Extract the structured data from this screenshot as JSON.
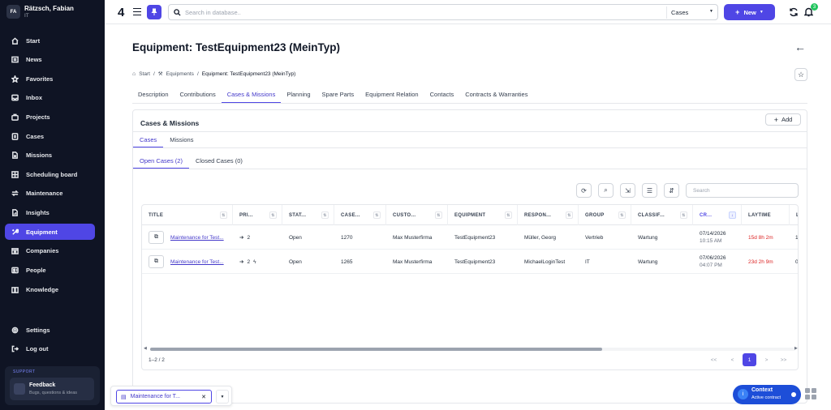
{
  "user": {
    "initials": "FA",
    "name": "Rätzsch, Fabian",
    "department": "IT"
  },
  "sidebar": {
    "items": [
      {
        "label": "Start",
        "icon": "home-icon"
      },
      {
        "label": "News",
        "icon": "newspaper-icon"
      },
      {
        "label": "Favorites",
        "icon": "star-icon"
      },
      {
        "label": "Inbox",
        "icon": "inbox-icon"
      },
      {
        "label": "Projects",
        "icon": "briefcase-icon"
      },
      {
        "label": "Cases",
        "icon": "cases-icon"
      },
      {
        "label": "Missions",
        "icon": "document-icon"
      },
      {
        "label": "Scheduling board",
        "icon": "grid-icon"
      },
      {
        "label": "Maintenance",
        "icon": "arrows-icon"
      },
      {
        "label": "Insights",
        "icon": "chart-icon"
      },
      {
        "label": "Equipment",
        "icon": "wrench-icon",
        "active": true
      },
      {
        "label": "Companies",
        "icon": "building-icon"
      },
      {
        "label": "People",
        "icon": "people-icon"
      },
      {
        "label": "Knowledge",
        "icon": "book-icon"
      }
    ],
    "settings_label": "Settings",
    "logout_label": "Log out",
    "support_label": "SUPPORT",
    "feedback_title": "Feedback",
    "feedback_sub": "Bugs, questions & ideas"
  },
  "topbar": {
    "logo": "4",
    "search_placeholder": "Search in database..",
    "scope": "Cases",
    "new_label": "New",
    "notification_count": "3"
  },
  "page": {
    "title": "Equipment: TestEquipment23 (MeinTyp)",
    "breadcrumb": [
      "Start",
      "Equipments",
      "Equipment: TestEquipment23 (MeinTyp)"
    ],
    "tabs": [
      "Description",
      "Contributions",
      "Cases & Missions",
      "Planning",
      "Spare Parts",
      "Equipment Relation",
      "Contacts",
      "Contracts & Warranties"
    ],
    "active_tab": 2
  },
  "panel": {
    "title": "Cases & Missions",
    "add_label": "Add",
    "subtabs": [
      "Cases",
      "Missions"
    ],
    "case_tabs": [
      "Open Cases (2)",
      "Closed Cases (0)"
    ],
    "search_placeholder": "Search"
  },
  "grid": {
    "columns": [
      "TITLE",
      "PRI...",
      "STAT...",
      "CASE...",
      "CUSTO...",
      "EQUIPMENT",
      "RESPON...",
      "GROUP",
      "CLASSIF...",
      "CR...",
      "LAYTIME",
      "L"
    ],
    "rows": [
      {
        "title": "Maintenance for Test...",
        "priority": "2",
        "status": "Open",
        "case": "1270",
        "customer": "Max Musterfirma",
        "equipment": "TestEquipment23",
        "responsible": "Müller, Georg",
        "group": "Vertrieb",
        "classification": "Wartung",
        "created_date": "07/14/2026",
        "created_time": "10:15 AM",
        "laytime": "15d 8h 2m",
        "extra": "1"
      },
      {
        "title": "Maintenance for Test...",
        "priority": "2",
        "status": "Open",
        "case": "1265",
        "customer": "Max Musterfirma",
        "equipment": "TestEquipment23",
        "responsible": "MichaelLoginTest",
        "group": "IT",
        "classification": "Wartung",
        "created_date": "07/06/2026",
        "created_time": "04:07 PM",
        "laytime": "23d 2h 9m",
        "extra": "0"
      }
    ],
    "count": "1–2 / 2",
    "pager": [
      "<<",
      "<",
      "1",
      ">",
      ">>"
    ],
    "scroll_fraction": 0.7
  },
  "taskbar": {
    "chip_label": "Maintenance for T..."
  },
  "context": {
    "title": "Context",
    "subtitle": "Active contract"
  },
  "colors": {
    "accent": "#4f46e5",
    "sidebar_bg": "#0f1424",
    "laytime": "#dc2626"
  }
}
